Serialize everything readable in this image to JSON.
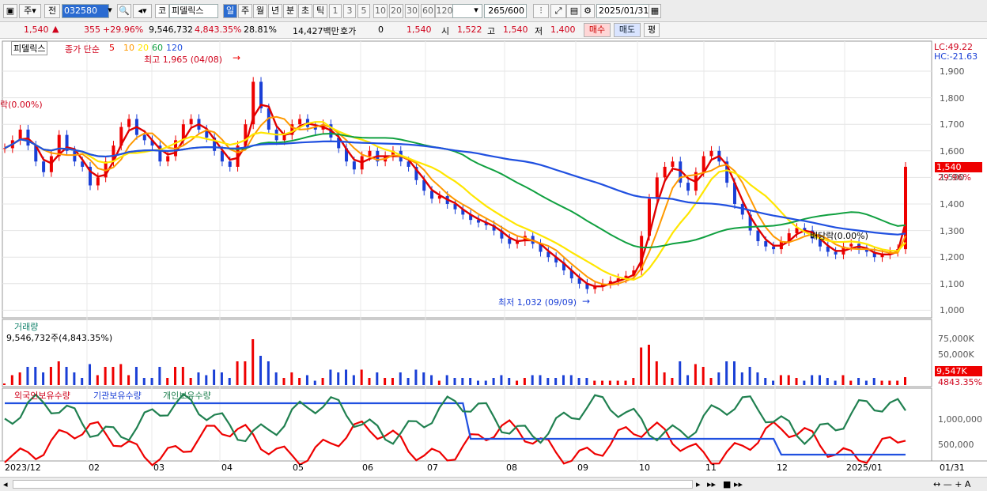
{
  "toolbar": {
    "market": "주",
    "compare": "전",
    "code": "032580",
    "market_badge": "코",
    "name": "피델릭스",
    "periods": [
      "일",
      "주",
      "월",
      "년",
      "분",
      "초",
      "틱"
    ],
    "active_period": "일",
    "minutes": [
      "1",
      "3",
      "5",
      "10",
      "20",
      "30",
      "60",
      "120"
    ],
    "count": "265",
    "count_total": "/600",
    "date": "2025/01/31"
  },
  "quote": {
    "price": "1,540",
    "change": "355",
    "change_pct": "+29.96%",
    "volume": "9,546,732",
    "vol_ratio": "4,843.35%",
    "turnover": "28.81%",
    "amount": "14,427백만",
    "hoga_label": "호가",
    "hoga": "0",
    "hoga_price": "1,540",
    "open_label": "시",
    "open": "1,522",
    "high_label": "고",
    "high": "1,540",
    "low_label": "저",
    "low": "1,400",
    "buy": "매수",
    "sell": "매도",
    "flat": "평"
  },
  "legend": {
    "name": "피델릭스",
    "ma_title": "종가 단순",
    "ma": [
      "5",
      "10",
      "20",
      "60",
      "120"
    ],
    "ma_colors": [
      "#e00000",
      "#ff9900",
      "#ffe600",
      "#10a040",
      "#2050e0"
    ]
  },
  "annotations": {
    "high": "최고 1,965 (04/08)",
    "low": "최저 1,032 (09/09)",
    "ex_left": "락(0.00%)",
    "ex_right": "배당락(0.00%)",
    "lc": "LC:49.22",
    "hc": "HC:-21.63",
    "last_price": "1,540",
    "last_pct": "29.96%"
  },
  "volume_panel": {
    "title": "거래량",
    "value": "9,546,732주(4,843.35%)",
    "last": "9,547K",
    "last_pct": "4843.35%"
  },
  "owner_panel": {
    "foreign": "외국인보유수량",
    "inst": "기관보유수량",
    "indiv": "개인보유수량"
  },
  "price_axis": [
    "1,900",
    "1,800",
    "1,700",
    "1,600",
    "1,500",
    "1,400",
    "1,300",
    "1,200",
    "1,100",
    "1,000"
  ],
  "volume_axis": [
    "75,000K",
    "50,000K",
    "25,000K"
  ],
  "owner_axis": [
    "1,000,000",
    "500,000"
  ],
  "date_axis": [
    "2023/12",
    "02",
    "03",
    "04",
    "05",
    "06",
    "07",
    "08",
    "09",
    "10",
    "11",
    "12",
    "2025/01"
  ],
  "date_axis_right": "01/31",
  "chart_data": {
    "type": "line",
    "title": "피델릭스",
    "y_range": [
      1000,
      1950
    ],
    "series": [
      {
        "name": "종가",
        "values": [
          1610,
          1640,
          1680,
          1620,
          1560,
          1520,
          1580,
          1660,
          1600,
          1560,
          1540,
          1470,
          1500,
          1560,
          1620,
          1690,
          1720,
          1660,
          1640,
          1620,
          1560,
          1580,
          1640,
          1700,
          1720,
          1680,
          1650,
          1600,
          1560,
          1540,
          1620,
          1700,
          1860,
          1760,
          1680,
          1640,
          1660,
          1700,
          1720,
          1690,
          1680,
          1700,
          1650,
          1610,
          1560,
          1530,
          1580,
          1600,
          1560,
          1580,
          1600,
          1560,
          1540,
          1490,
          1450,
          1420,
          1430,
          1400,
          1380,
          1360,
          1340,
          1330,
          1320,
          1300,
          1270,
          1250,
          1260,
          1280,
          1250,
          1220,
          1200,
          1180,
          1150,
          1120,
          1100,
          1080,
          1090,
          1100,
          1110,
          1120,
          1130,
          1150,
          1280,
          1420,
          1500,
          1540,
          1560,
          1480,
          1450,
          1520,
          1580,
          1600,
          1560,
          1480,
          1400,
          1360,
          1300,
          1260,
          1240,
          1230,
          1260,
          1290,
          1310,
          1300,
          1270,
          1240,
          1220,
          1210,
          1240,
          1250,
          1230,
          1220,
          1200,
          1210,
          1220,
          1230,
          1540
        ]
      }
    ]
  }
}
